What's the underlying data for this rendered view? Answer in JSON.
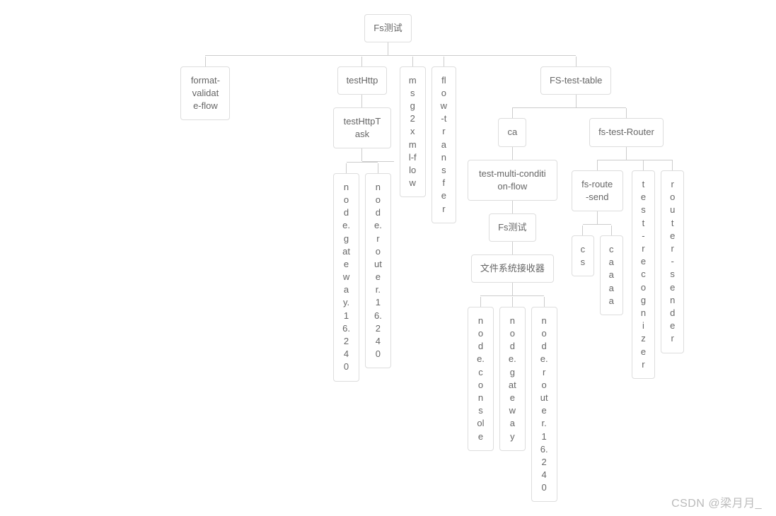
{
  "tree": {
    "root": "Fs测试",
    "level1": {
      "a": "format-validate-flow",
      "b": "testHttp",
      "c": "msg2xml-flow",
      "d": "flow-transfer",
      "e": "FS-test-table"
    },
    "testHttp": {
      "task": "testHttpTask",
      "children": {
        "a": "node.gateway.16.240",
        "b": "node.router.16.240"
      }
    },
    "fstest": {
      "ca": "ca",
      "router": "fs-test-Router",
      "multi": "test-multi-condition-flow",
      "fs2": "Fs测试",
      "receiver": "文件系统接收器",
      "recvChildren": {
        "a": "node.console",
        "b": "node.gateway",
        "c": "node.router.16.240"
      },
      "routerChildren": {
        "a": "fs-route-send",
        "b": "test-recognizer",
        "c": "router-sender"
      },
      "sendChildren": {
        "a": "cs",
        "b": "caaaa"
      }
    }
  },
  "watermark": "CSDN @梁月月_"
}
